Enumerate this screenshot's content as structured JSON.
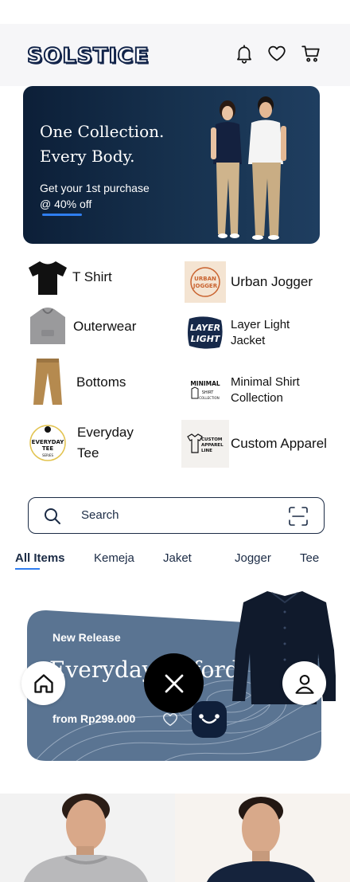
{
  "header": {
    "logo": "SOLSTICE",
    "icons": [
      "bell-icon",
      "heart-icon",
      "cart-icon"
    ]
  },
  "hero": {
    "title": "One Collection.\nEvery Body.",
    "subtitle": "Get your 1st purchase\n@ 40% off"
  },
  "categories": [
    {
      "label": "T Shirt",
      "icon": "tshirt-thumb"
    },
    {
      "label": "Urban Jogger",
      "icon": "urban-jogger-logo",
      "logo_text": "URBAN\nJOGGER"
    },
    {
      "label": "Outerwear",
      "icon": "hoodie-thumb"
    },
    {
      "label": "Layer Light\nJacket",
      "icon": "layer-light-logo",
      "logo_text": "LAYER\nLIGHT"
    },
    {
      "label": "Bottoms",
      "icon": "pants-thumb"
    },
    {
      "label": "Minimal Shirt\nCollection",
      "icon": "minimal-logo",
      "logo_text": "MINIMAL\nSHIRT\nCOLLECTION"
    },
    {
      "label": "Everyday\nTee",
      "icon": "everyday-tee-logo",
      "logo_text": "EVERYDAY\nTEE\nSERIES"
    },
    {
      "label": "Custom Apparel",
      "icon": "custom-apparel-logo",
      "logo_text": "CUSTOM\nAPPAREL\nLINE"
    }
  ],
  "search": {
    "placeholder": "Search"
  },
  "tabs": [
    "All Items",
    "Kemeja",
    "Jaket",
    "Jogger",
    "Tee"
  ],
  "promo": {
    "label": "New Release",
    "title": "Everyday Oxford",
    "price": "from Rp299.000"
  },
  "colors": {
    "navy": "#12244a",
    "accent": "#2f7ef0",
    "promo": "#5a7492"
  }
}
